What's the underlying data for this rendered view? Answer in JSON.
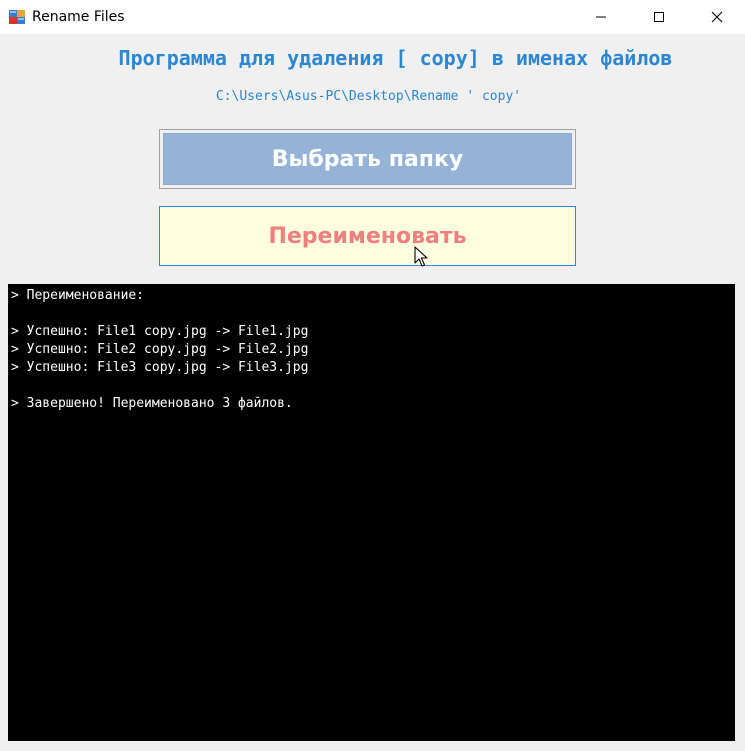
{
  "window": {
    "title": "Rename Files"
  },
  "header": {
    "heading": "Программа для удаления [ copy] в именах файлов",
    "path": "C:\\Users\\Asus-PC\\Desktop\\Rename ' copy'"
  },
  "buttons": {
    "select_folder_label": "Выбрать папку",
    "rename_label": "Переименовать"
  },
  "console": {
    "lines": [
      "> Переименование:",
      "",
      "> Успешно: File1 copy.jpg -> File1.jpg",
      "> Успешно: File2 copy.jpg -> File2.jpg",
      "> Успешно: File3 copy.jpg -> File3.jpg",
      "",
      "> Завершено! Переименовано 3 файлов."
    ]
  },
  "colors": {
    "heading": "#2b86d4",
    "select_button_fill": "#94b3d6",
    "rename_button_fill": "#fffee0",
    "rename_button_text": "#f08080",
    "console_background": "#000000"
  },
  "icons": {
    "app": "app-icon",
    "minimize": "minimize-icon",
    "maximize": "maximize-icon",
    "close": "close-icon",
    "cursor": "mouse-cursor-icon"
  }
}
